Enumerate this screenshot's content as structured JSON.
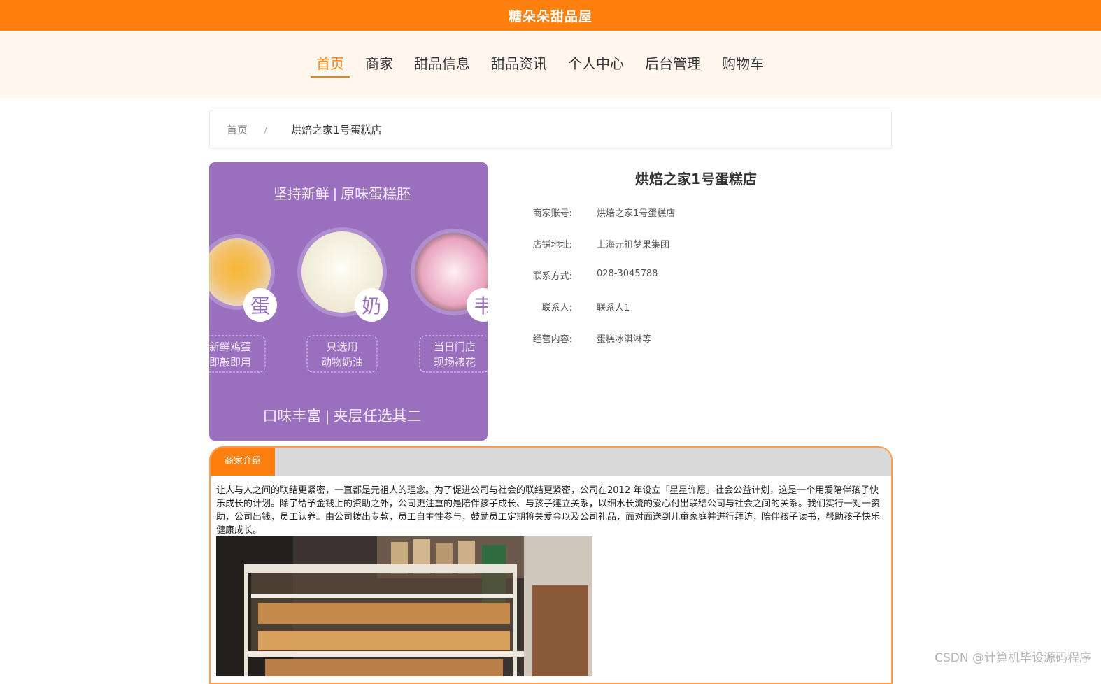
{
  "site": {
    "title": "糖朵朵甜品屋"
  },
  "nav": {
    "items": [
      {
        "label": "首页",
        "active": true
      },
      {
        "label": "商家"
      },
      {
        "label": "甜品信息"
      },
      {
        "label": "甜品资讯"
      },
      {
        "label": "个人中心"
      },
      {
        "label": "后台管理"
      },
      {
        "label": "购物车"
      }
    ]
  },
  "breadcrumb": {
    "home": "首页",
    "separator": "/",
    "current": "烘焙之家1号蛋糕店"
  },
  "promo": {
    "top_text": "坚持新鲜 | 原味蛋糕胚",
    "badges": [
      "蛋",
      "奶",
      "韦"
    ],
    "captions": [
      {
        "line1": "新鲜鸡蛋",
        "line2": "即敲即用"
      },
      {
        "line1": "只选用",
        "line2": "动物奶油"
      },
      {
        "line1": "当日门店",
        "line2": "现场裱花"
      }
    ],
    "bottom_text": "口味丰富 | 夹层任选其二",
    "color": "#9a6fbe"
  },
  "store": {
    "name": "烘焙之家1号蛋糕店",
    "fields": [
      {
        "label": "商家账号:",
        "value": "烘焙之家1号蛋糕店"
      },
      {
        "label": "店铺地址:",
        "value": "上海元祖梦果集团"
      },
      {
        "label": "联系方式:",
        "value": "028-3045788"
      },
      {
        "label": "联系人:",
        "value": "联系人1"
      },
      {
        "label": "经营内容:",
        "value": "蛋糕冰淇淋等"
      }
    ]
  },
  "intro": {
    "tab_label": "商家介绍",
    "text": "让人与人之间的联结更紧密，一直都是元祖人的理念。为了促进公司与社会的联结更紧密，公司在2012 年设立「星星许愿」社会公益计划，这是一个用爱陪伴孩子快乐成长的计划。除了给予金钱上的资助之外，公司更注重的是陪伴孩子成长、与孩子建立关系，以细水长流的爱心付出联结公司与社会之间的关系。我们实行一对一资助，公司出钱，员工认养。由公司拨出专款，员工自主性参与，鼓励员工定期将关爱金以及公司礼品，面对面送到儿童家庭并进行拜访，陪伴孩子读书，帮助孩子快乐健康成长。"
  },
  "watermark": "CSDN @计算机毕设源码程序",
  "colors": {
    "accent": "#ff7f0f",
    "nav_bg": "#fff7ee",
    "tab_bar": "#d9d9d9"
  }
}
